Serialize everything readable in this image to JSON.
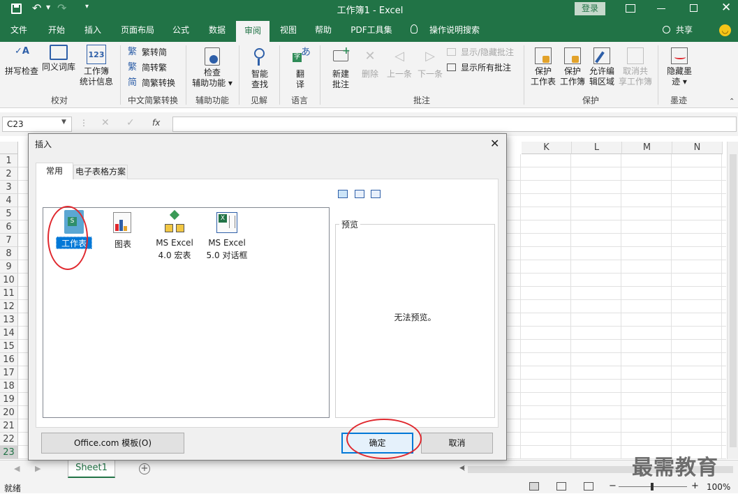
{
  "window": {
    "title": "工作簿1  -  Excel",
    "login": "登录"
  },
  "qat": {
    "save": "保存",
    "undo": "撤消",
    "redo": "恢复"
  },
  "tabs": [
    "文件",
    "开始",
    "插入",
    "页面布局",
    "公式",
    "数据",
    "审阅",
    "视图",
    "帮助",
    "PDF工具集",
    "操作说明搜索"
  ],
  "active_tab": "审阅",
  "share": "共享",
  "ribbon": {
    "proofing": {
      "spell": "拼写检查",
      "thesaurus": "同义词库",
      "stats1": "工作簿",
      "stats2": "统计信息",
      "group": "校对"
    },
    "chinese": {
      "t2s": "繁转简",
      "s2t": "简转繁",
      "convert": "简繁转换",
      "group": "中文简繁转换"
    },
    "access": {
      "check1": "检查",
      "check2": "辅助功能",
      "group": "辅助功能"
    },
    "insights": {
      "lookup1": "智能",
      "lookup2": "查找",
      "group": "见解"
    },
    "language": {
      "translate1": "翻",
      "translate2": "译",
      "group": "语言"
    },
    "comments": {
      "new1": "新建",
      "new2": "批注",
      "delete": "删除",
      "prev": "上一条",
      "next": "下一条",
      "showhide": "显示/隐藏批注",
      "showall": "显示所有批注",
      "group": "批注"
    },
    "protect": {
      "sheet1": "保护",
      "sheet2": "工作表",
      "book1": "保护",
      "book2": "工作簿",
      "range1": "允许编",
      "range2": "辑区域",
      "unshare1": "取消共",
      "unshare2": "享工作簿",
      "group": "保护"
    },
    "ink": {
      "hide1": "隐藏墨",
      "hide2": "迹",
      "group": "墨迹"
    }
  },
  "formula": {
    "namebox": "C23",
    "fx": "fx"
  },
  "columns": [
    "K",
    "L",
    "M",
    "N"
  ],
  "rows": [
    "1",
    "2",
    "3",
    "4",
    "5",
    "6",
    "7",
    "8",
    "9",
    "10",
    "11",
    "12",
    "13",
    "14",
    "15",
    "16",
    "17",
    "18",
    "19",
    "20",
    "21",
    "22",
    "23"
  ],
  "dialog": {
    "title": "插入",
    "tabs": [
      "常用",
      "电子表格方案"
    ],
    "items": [
      {
        "label": "工作表",
        "icon": "worksheet-icon",
        "selected": true
      },
      {
        "label": "图表",
        "icon": "chart-icon"
      },
      {
        "label1": "MS Excel",
        "label2": "4.0 宏表",
        "icon": "macro-sheet-icon"
      },
      {
        "label1": "MS Excel",
        "label2": "5.0 对话框",
        "icon": "dialog-sheet-icon"
      }
    ],
    "preview_label": "预览",
    "no_preview": "无法预览。",
    "templates_button": "Office.com 模板(O)",
    "ok_button": "确定",
    "cancel_button": "取消"
  },
  "sheet_tab": "Sheet1",
  "status": {
    "ready": "就绪",
    "zoom": "100%"
  },
  "watermark": "最需教育",
  "colors": {
    "accent": "#217346",
    "selection": "#0078d7",
    "annotation": "#e0282e"
  }
}
